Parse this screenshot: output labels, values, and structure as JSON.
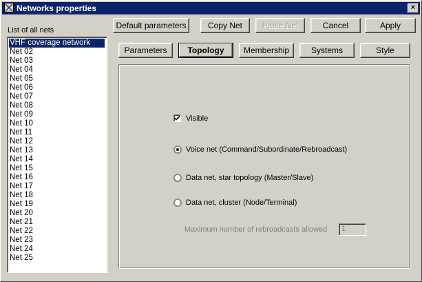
{
  "window": {
    "title": "Networks properties"
  },
  "toolbar": {
    "default_params": "Default parameters",
    "copy_net": "Copy Net",
    "paste_net": "Paste Net",
    "cancel": "Cancel",
    "apply": "Apply"
  },
  "net_list": {
    "label": "List of all nets",
    "selected_index": 0,
    "items": [
      "VHF coverage network",
      "Net 02",
      "Net 03",
      "Net 04",
      "Net 05",
      "Net 06",
      "Net 07",
      "Net 08",
      "Net 09",
      "Net 10",
      "Net 11",
      "Net 12",
      "Net 13",
      "Net 14",
      "Net 15",
      "Net 16",
      "Net 17",
      "Net 18",
      "Net 19",
      "Net 20",
      "Net 21",
      "Net 22",
      "Net 23",
      "Net 24",
      "Net 25"
    ]
  },
  "tabs": [
    "Parameters",
    "Topology",
    "Membership",
    "Systems",
    "Style"
  ],
  "active_tab": "Topology",
  "topology": {
    "visible_label": "Visible",
    "visible_checked": true,
    "options": [
      {
        "label": "Voice net (Command/Subordinate/Rebroadcast)",
        "selected": true
      },
      {
        "label": "Data net, star topology (Master/Slave)",
        "selected": false
      },
      {
        "label": "Data net, cluster (Node/Terminal)",
        "selected": false
      }
    ],
    "max_rebroadcasts_label": "Maximum number of rebroadcasts allowed",
    "max_rebroadcasts_value": "1"
  }
}
